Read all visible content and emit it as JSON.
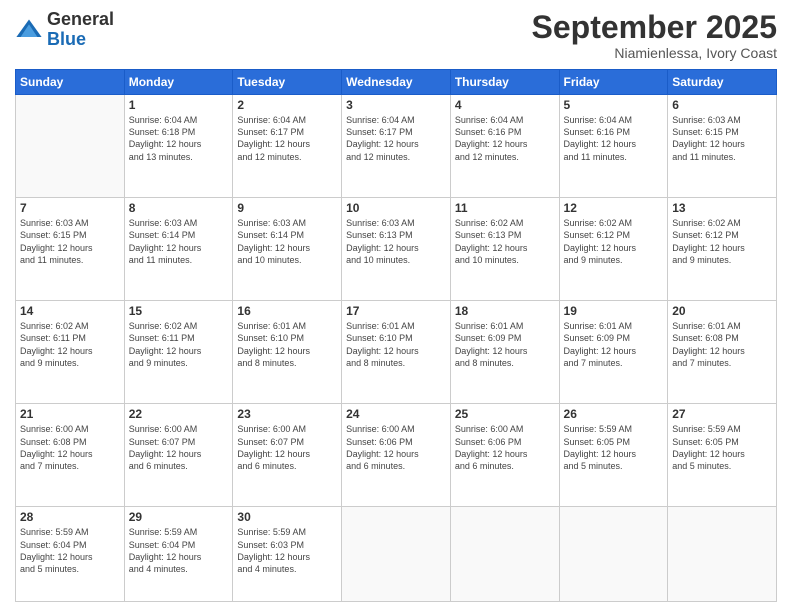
{
  "header": {
    "logo_general": "General",
    "logo_blue": "Blue",
    "month_title": "September 2025",
    "location": "Niamienlessa, Ivory Coast"
  },
  "days_of_week": [
    "Sunday",
    "Monday",
    "Tuesday",
    "Wednesday",
    "Thursday",
    "Friday",
    "Saturday"
  ],
  "weeks": [
    [
      {
        "day": "",
        "info": ""
      },
      {
        "day": "1",
        "info": "Sunrise: 6:04 AM\nSunset: 6:18 PM\nDaylight: 12 hours\nand 13 minutes."
      },
      {
        "day": "2",
        "info": "Sunrise: 6:04 AM\nSunset: 6:17 PM\nDaylight: 12 hours\nand 12 minutes."
      },
      {
        "day": "3",
        "info": "Sunrise: 6:04 AM\nSunset: 6:17 PM\nDaylight: 12 hours\nand 12 minutes."
      },
      {
        "day": "4",
        "info": "Sunrise: 6:04 AM\nSunset: 6:16 PM\nDaylight: 12 hours\nand 12 minutes."
      },
      {
        "day": "5",
        "info": "Sunrise: 6:04 AM\nSunset: 6:16 PM\nDaylight: 12 hours\nand 11 minutes."
      },
      {
        "day": "6",
        "info": "Sunrise: 6:03 AM\nSunset: 6:15 PM\nDaylight: 12 hours\nand 11 minutes."
      }
    ],
    [
      {
        "day": "7",
        "info": "Sunrise: 6:03 AM\nSunset: 6:15 PM\nDaylight: 12 hours\nand 11 minutes."
      },
      {
        "day": "8",
        "info": "Sunrise: 6:03 AM\nSunset: 6:14 PM\nDaylight: 12 hours\nand 11 minutes."
      },
      {
        "day": "9",
        "info": "Sunrise: 6:03 AM\nSunset: 6:14 PM\nDaylight: 12 hours\nand 10 minutes."
      },
      {
        "day": "10",
        "info": "Sunrise: 6:03 AM\nSunset: 6:13 PM\nDaylight: 12 hours\nand 10 minutes."
      },
      {
        "day": "11",
        "info": "Sunrise: 6:02 AM\nSunset: 6:13 PM\nDaylight: 12 hours\nand 10 minutes."
      },
      {
        "day": "12",
        "info": "Sunrise: 6:02 AM\nSunset: 6:12 PM\nDaylight: 12 hours\nand 9 minutes."
      },
      {
        "day": "13",
        "info": "Sunrise: 6:02 AM\nSunset: 6:12 PM\nDaylight: 12 hours\nand 9 minutes."
      }
    ],
    [
      {
        "day": "14",
        "info": "Sunrise: 6:02 AM\nSunset: 6:11 PM\nDaylight: 12 hours\nand 9 minutes."
      },
      {
        "day": "15",
        "info": "Sunrise: 6:02 AM\nSunset: 6:11 PM\nDaylight: 12 hours\nand 9 minutes."
      },
      {
        "day": "16",
        "info": "Sunrise: 6:01 AM\nSunset: 6:10 PM\nDaylight: 12 hours\nand 8 minutes."
      },
      {
        "day": "17",
        "info": "Sunrise: 6:01 AM\nSunset: 6:10 PM\nDaylight: 12 hours\nand 8 minutes."
      },
      {
        "day": "18",
        "info": "Sunrise: 6:01 AM\nSunset: 6:09 PM\nDaylight: 12 hours\nand 8 minutes."
      },
      {
        "day": "19",
        "info": "Sunrise: 6:01 AM\nSunset: 6:09 PM\nDaylight: 12 hours\nand 7 minutes."
      },
      {
        "day": "20",
        "info": "Sunrise: 6:01 AM\nSunset: 6:08 PM\nDaylight: 12 hours\nand 7 minutes."
      }
    ],
    [
      {
        "day": "21",
        "info": "Sunrise: 6:00 AM\nSunset: 6:08 PM\nDaylight: 12 hours\nand 7 minutes."
      },
      {
        "day": "22",
        "info": "Sunrise: 6:00 AM\nSunset: 6:07 PM\nDaylight: 12 hours\nand 6 minutes."
      },
      {
        "day": "23",
        "info": "Sunrise: 6:00 AM\nSunset: 6:07 PM\nDaylight: 12 hours\nand 6 minutes."
      },
      {
        "day": "24",
        "info": "Sunrise: 6:00 AM\nSunset: 6:06 PM\nDaylight: 12 hours\nand 6 minutes."
      },
      {
        "day": "25",
        "info": "Sunrise: 6:00 AM\nSunset: 6:06 PM\nDaylight: 12 hours\nand 6 minutes."
      },
      {
        "day": "26",
        "info": "Sunrise: 5:59 AM\nSunset: 6:05 PM\nDaylight: 12 hours\nand 5 minutes."
      },
      {
        "day": "27",
        "info": "Sunrise: 5:59 AM\nSunset: 6:05 PM\nDaylight: 12 hours\nand 5 minutes."
      }
    ],
    [
      {
        "day": "28",
        "info": "Sunrise: 5:59 AM\nSunset: 6:04 PM\nDaylight: 12 hours\nand 5 minutes."
      },
      {
        "day": "29",
        "info": "Sunrise: 5:59 AM\nSunset: 6:04 PM\nDaylight: 12 hours\nand 4 minutes."
      },
      {
        "day": "30",
        "info": "Sunrise: 5:59 AM\nSunset: 6:03 PM\nDaylight: 12 hours\nand 4 minutes."
      },
      {
        "day": "",
        "info": ""
      },
      {
        "day": "",
        "info": ""
      },
      {
        "day": "",
        "info": ""
      },
      {
        "day": "",
        "info": ""
      }
    ]
  ]
}
